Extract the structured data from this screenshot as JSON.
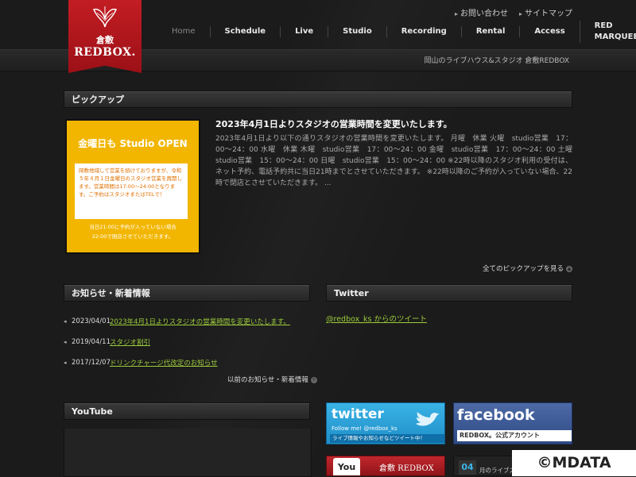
{
  "header": {
    "logo_kanji": "倉敷",
    "logo_text": "REDBOX.",
    "util_links": [
      {
        "label": "お問い合わせ"
      },
      {
        "label": "サイトマップ"
      }
    ],
    "nav": [
      {
        "label": "Home"
      },
      {
        "label": "Schedule"
      },
      {
        "label": "Live"
      },
      {
        "label": "Studio"
      },
      {
        "label": "Recording"
      },
      {
        "label": "Rental"
      },
      {
        "label": "Access"
      },
      {
        "label": "RED MARQUEE"
      }
    ],
    "tagline": "岡山のライブハウス&スタジオ 倉敷REDBOX"
  },
  "pickup": {
    "section_title": "ピックアップ",
    "image": {
      "headline": "金曜日も Studio OPEN",
      "box_text": "岡敷地域して営業を続けておりますが、令和５年４月１日金曜日のスタジオ営業を再開します。営業時間は17:00〜24:00となります。ご予約はスタジオまたはTELで！",
      "footer_line1": "当日21:00に予約が入っていない場合",
      "footer_line2": "22:00で閉店させていただきます。"
    },
    "title": "2023年4月1日よりスタジオの営業時間を変更いたします。",
    "body": "2023年4月1日より以下の通りスタジオの営業時間を変更いたします。 月曜　休業 火曜　studio営業　17：00～24：00 水曜　休業 木曜　studio営業　17：00～24：00 金曜　studio営業　17：00～24：00 土曜　studio営業　15：00～24：00 日曜　studio営業　15：00～24：00 ※22時以降のスタジオ利用の受付は、ネット予約、電話予約共に当日21時までとさせていただきます。 ※22時以降のご予約が入っていない場合、22時で閉店とさせていただきます。 ...",
    "see_all": "全てのピックアップを見る"
  },
  "news": {
    "section_title": "お知らせ・新着情報",
    "items": [
      {
        "date": "2023/04/01",
        "title": "2023年4月1日よりスタジオの営業時間を変更いたします。"
      },
      {
        "date": "2019/04/11",
        "title": "スタジオ割引"
      },
      {
        "date": "2017/12/07",
        "title": "ドリンクチャージ代改定のお知らせ"
      }
    ],
    "more": "以前のお知らせ・新着情報"
  },
  "twitter": {
    "section_title": "Twitter",
    "link": "@redbox_ks からのツイート"
  },
  "youtube": {
    "section_title": "YouTube"
  },
  "banners": {
    "twitter": {
      "logo": "twitter",
      "line1": "Follow me! @redbox_ks",
      "line2": "ライブ情報やお知らせなどツイート中！"
    },
    "facebook": {
      "logo": "facebook",
      "sub": "REDBOX。公式アカウント"
    },
    "youtube": {
      "you": "You",
      "text": "倉敷 REDBOX"
    },
    "calendar": {
      "num": "04",
      "text": "月のライブスケジュール"
    }
  },
  "watermark": "©MDATA",
  "colors": {
    "accent_red": "#c21d23",
    "link_green": "#9ccc3a",
    "pickup_yellow": "#f2b600"
  }
}
